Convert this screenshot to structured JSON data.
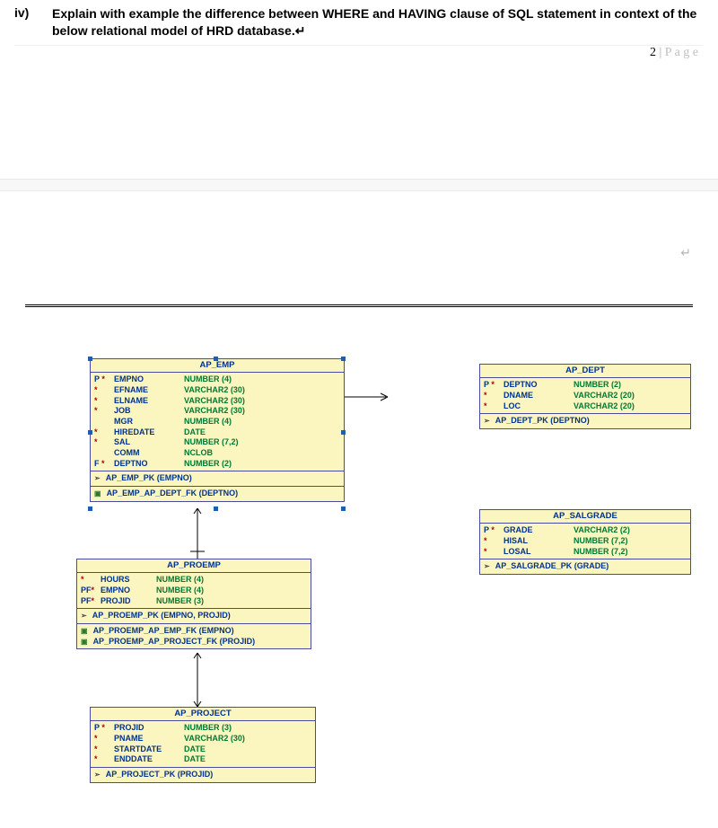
{
  "question": {
    "label": "iv)",
    "text": "Explain with example the difference between WHERE and HAVING clause of SQL statement in context of the below relational model of HRD database.↵"
  },
  "page_footer": {
    "num": "2",
    "sep": " | ",
    "word": "P a g e"
  },
  "return_glyph": "↵",
  "entities": {
    "emp": {
      "title": "AP_EMP",
      "cols": [
        {
          "flag": "P  *",
          "name": "EMPNO",
          "type": "NUMBER (4)"
        },
        {
          "flag": "   *",
          "name": "EFNAME",
          "type": "VARCHAR2 (30)"
        },
        {
          "flag": "   *",
          "name": "ELNAME",
          "type": "VARCHAR2 (30)"
        },
        {
          "flag": "   *",
          "name": "JOB",
          "type": "VARCHAR2 (30)"
        },
        {
          "flag": "",
          "name": "MGR",
          "type": "NUMBER (4)"
        },
        {
          "flag": "   *",
          "name": "HIREDATE",
          "type": "DATE"
        },
        {
          "flag": "   *",
          "name": "SAL",
          "type": "NUMBER (7,2)"
        },
        {
          "flag": "",
          "name": "COMM",
          "type": "NCLOB"
        },
        {
          "flag": "F  *",
          "name": "DEPTNO",
          "type": "NUMBER (2)"
        }
      ],
      "pk": "AP_EMP_PK (EMPNO)",
      "fks": [
        "AP_EMP_AP_DEPT_FK (DEPTNO)"
      ]
    },
    "dept": {
      "title": "AP_DEPT",
      "cols": [
        {
          "flag": "P  *",
          "name": "DEPTNO",
          "type": "NUMBER (2)"
        },
        {
          "flag": "   *",
          "name": "DNAME",
          "type": "VARCHAR2 (20)"
        },
        {
          "flag": "   *",
          "name": "LOC",
          "type": "VARCHAR2 (20)"
        }
      ],
      "pk": "AP_DEPT_PK (DEPTNO)"
    },
    "salgrade": {
      "title": "AP_SALGRADE",
      "cols": [
        {
          "flag": "P  *",
          "name": "GRADE",
          "type": "VARCHAR2 (2)"
        },
        {
          "flag": "   *",
          "name": "HISAL",
          "type": "NUMBER (7,2)"
        },
        {
          "flag": "   *",
          "name": "LOSAL",
          "type": "NUMBER (7,2)"
        }
      ],
      "pk": "AP_SALGRADE_PK (GRADE)"
    },
    "proemp": {
      "title": "AP_PROEMP",
      "cols": [
        {
          "flag": "   *",
          "name": "HOURS",
          "type": "NUMBER (4)"
        },
        {
          "flag": "PF*",
          "name": "EMPNO",
          "type": "NUMBER (4)"
        },
        {
          "flag": "PF*",
          "name": "PROJID",
          "type": "NUMBER (3)"
        }
      ],
      "pk": "AP_PROEMP_PK (EMPNO, PROJID)",
      "fks": [
        "AP_PROEMP_AP_EMP_FK (EMPNO)",
        "AP_PROEMP_AP_PROJECT_FK (PROJID)"
      ]
    },
    "project": {
      "title": "AP_PROJECT",
      "cols": [
        {
          "flag": "P  *",
          "name": "PROJID",
          "type": "NUMBER (3)"
        },
        {
          "flag": "   *",
          "name": "PNAME",
          "type": "VARCHAR2 (30)"
        },
        {
          "flag": "   *",
          "name": "STARTDATE",
          "type": "DATE"
        },
        {
          "flag": "   *",
          "name": "ENDDATE",
          "type": "DATE"
        }
      ],
      "pk": "AP_PROJECT_PK (PROJID)"
    }
  }
}
